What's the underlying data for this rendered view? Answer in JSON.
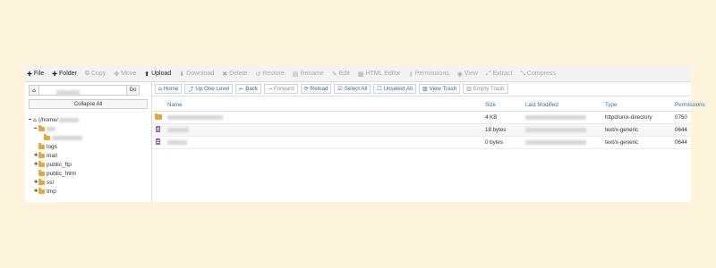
{
  "toolbar": {
    "items": [
      {
        "icon": "plus-icon",
        "glyph": "✚",
        "label": "File",
        "enabled": true
      },
      {
        "icon": "plus-icon",
        "glyph": "✚",
        "label": "Folder",
        "enabled": true
      },
      {
        "icon": "copy-icon",
        "glyph": "⧉",
        "label": "Copy",
        "enabled": false
      },
      {
        "icon": "move-icon",
        "glyph": "✥",
        "label": "Move",
        "enabled": false
      },
      {
        "icon": "upload-icon",
        "glyph": "⬆",
        "label": "Upload",
        "enabled": true
      },
      {
        "icon": "download-icon",
        "glyph": "⬇",
        "label": "Download",
        "enabled": false
      },
      {
        "icon": "delete-icon",
        "glyph": "✖",
        "label": "Delete",
        "enabled": false
      },
      {
        "icon": "restore-icon",
        "glyph": "↺",
        "label": "Restore",
        "enabled": false
      },
      {
        "icon": "rename-icon",
        "glyph": "▤",
        "label": "Rename",
        "enabled": false
      },
      {
        "icon": "edit-icon",
        "glyph": "✎",
        "label": "Edit",
        "enabled": false
      },
      {
        "icon": "html-editor-icon",
        "glyph": "▦",
        "label": "HTML Editor",
        "enabled": false
      },
      {
        "icon": "key-icon",
        "glyph": "⚷",
        "label": "Permissions",
        "enabled": false
      },
      {
        "icon": "eye-icon",
        "glyph": "◉",
        "label": "View",
        "enabled": false
      },
      {
        "icon": "extract-icon",
        "glyph": "⤢",
        "label": "Extract",
        "enabled": false
      },
      {
        "icon": "compress-icon",
        "glyph": "⤡",
        "label": "Compress",
        "enabled": false
      }
    ]
  },
  "left": {
    "go_label": "Go",
    "collapse_label": "Collapse All",
    "root_label": "(/home/",
    "tree": [
      "logs",
      "mail",
      "public_ftp",
      "public_html",
      "ssl",
      "tmp"
    ]
  },
  "actions": [
    {
      "icon": "home-icon",
      "glyph": "⌂",
      "label": "Home",
      "enabled": true
    },
    {
      "icon": "level-up-icon",
      "glyph": "⤴",
      "label": "Up One Level",
      "enabled": true
    },
    {
      "icon": "back-arrow-icon",
      "glyph": "←",
      "label": "Back",
      "enabled": true
    },
    {
      "icon": "forward-arrow-icon",
      "glyph": "→",
      "label": "Forward",
      "enabled": false
    },
    {
      "icon": "reload-icon",
      "glyph": "⟳",
      "label": "Reload",
      "enabled": true
    },
    {
      "icon": "check-square-icon",
      "glyph": "☑",
      "label": "Select All",
      "enabled": true
    },
    {
      "icon": "square-icon",
      "glyph": "☐",
      "label": "Unselect All",
      "enabled": true
    },
    {
      "icon": "trash-icon",
      "glyph": "▥",
      "label": "View Trash",
      "enabled": true
    },
    {
      "icon": "trash-icon",
      "glyph": "▥",
      "label": "Empty Trash",
      "enabled": false
    }
  ],
  "table": {
    "headers": {
      "name": "Name",
      "size": "Size",
      "modified": "Last Modified",
      "type": "Type",
      "perms": "Permissions"
    },
    "rows": [
      {
        "kind": "folder",
        "size": "4 KB",
        "type": "httpd/unix-directory",
        "perms": "0750"
      },
      {
        "kind": "file",
        "size": "18 bytes",
        "type": "text/x-generic",
        "perms": "0644"
      },
      {
        "kind": "file",
        "size": "0 bytes",
        "type": "text/x-generic",
        "perms": "0644"
      }
    ]
  }
}
